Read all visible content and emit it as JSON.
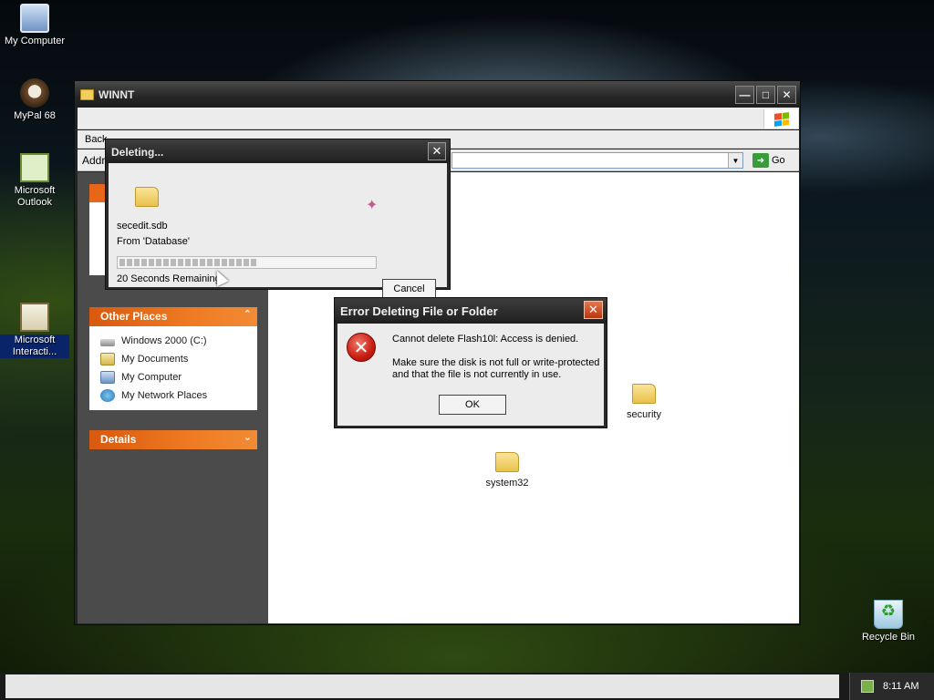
{
  "desktop": {
    "icons": [
      {
        "label": "My Computer",
        "icon": "my-computer-icon"
      },
      {
        "label": "MyPal 68",
        "icon": "mypal-icon"
      },
      {
        "label": "Microsoft Outlook",
        "icon": "outlook-icon"
      },
      {
        "label": "Microsoft Interacti...",
        "icon": "microsoft-interactive-icon"
      },
      {
        "label": "Recycle Bin",
        "icon": "recycle-bin-icon"
      }
    ]
  },
  "explorer": {
    "title": "WINNT",
    "toolbar_back": "Back",
    "address_label": "Address",
    "go_label": "Go",
    "other_places": {
      "header": "Other Places",
      "items": [
        {
          "label": "Windows 2000 (C:)",
          "icon": "drive-icon"
        },
        {
          "label": "My Documents",
          "icon": "my-documents-icon"
        },
        {
          "label": "My Computer",
          "icon": "my-computer-icon"
        },
        {
          "label": "My Network Places",
          "icon": "network-places-icon"
        }
      ]
    },
    "details_header": "Details",
    "files": [
      {
        "label": "security",
        "icon": "folder-icon"
      },
      {
        "label": "system32",
        "icon": "folder-icon"
      }
    ]
  },
  "deleting_dialog": {
    "title": "Deleting...",
    "file_name": "secedit.sdb",
    "from_text": "From 'Database'",
    "progress": 0.54,
    "remaining": "20 Seconds Remaining",
    "cancel_label": "Cancel"
  },
  "error_dialog": {
    "title": "Error Deleting File or Folder",
    "message": "Cannot delete Flash10l: Access is denied.",
    "detail": "Make sure the disk is not full or write-protected and that the file is not currently in use.",
    "ok_label": "OK"
  },
  "taskbar": {
    "clock": "8:11 AM"
  },
  "colors": {
    "accent_orange": "#ef7a22",
    "error_red": "#c81d12",
    "window_dark": "#232323"
  }
}
